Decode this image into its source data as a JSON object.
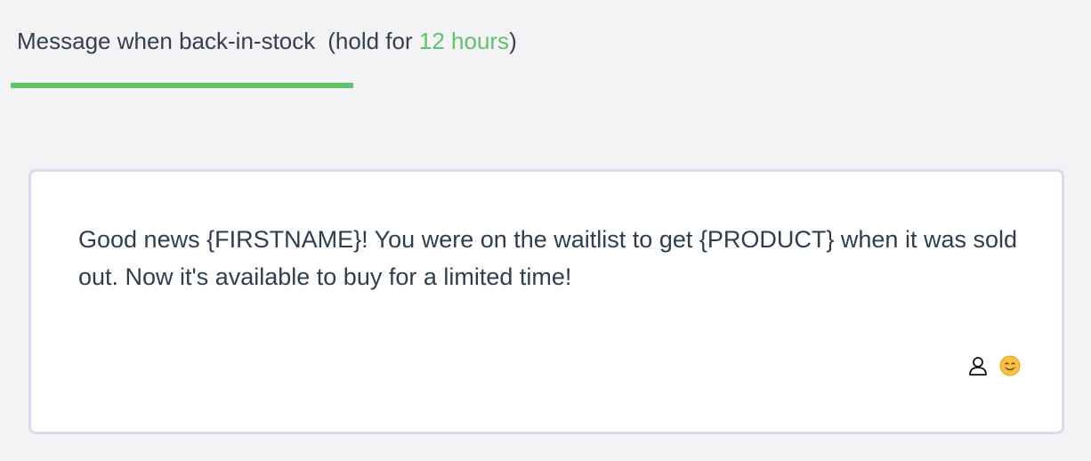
{
  "tab": {
    "label": "Message when back-in-stock",
    "hold_prefix": "(hold for ",
    "hold_value": "12 hours",
    "hold_suffix": ")"
  },
  "editor": {
    "message": "Good news {FIRSTNAME}! You were on the waitlist to get {PRODUCT} when it was sold out. Now it's available to buy for a limited time!",
    "toolbar": {
      "icons": [
        "person-icon",
        "smiley-emoji-icon"
      ]
    }
  },
  "colors": {
    "accent": "#5ec46a",
    "background": "#f3f2f5",
    "text": "#2f3e4e",
    "editor_border": "#d9dcec"
  }
}
